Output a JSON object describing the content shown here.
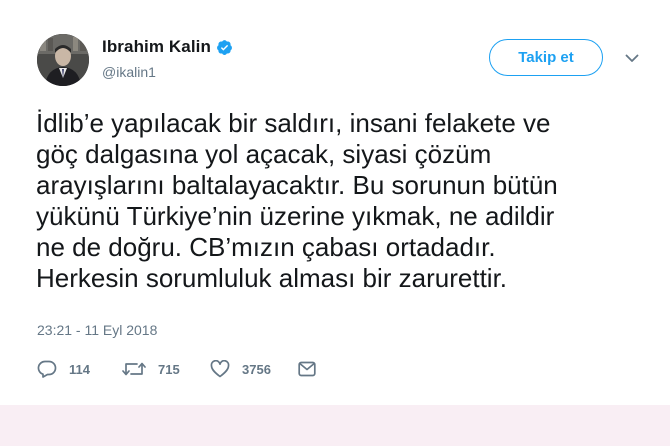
{
  "user": {
    "display_name": "Ibrahim Kalin",
    "handle": "@ikalin1",
    "verified": true,
    "avatar_icon": "profile-photo"
  },
  "follow_button": {
    "label": "Takip et"
  },
  "menu": {
    "icon": "chevron-down-icon"
  },
  "tweet": {
    "text": "İdlib’e yapılacak bir saldırı, insani felakete ve\ngöç dalgasına yol açacak, siyasi çözüm\narayışlarını baltalayacaktır. Bu sorunun bütün\nyükünü Türkiye’nin üzerine yıkmak, ne adildir\nne de doğru. CB’mızın çabası ortadadır.\nHerkesin sorumluluk alması bir zarurettir.",
    "timestamp": "23:21 - 11 Eyl 2018"
  },
  "actions": {
    "reply_count": "114",
    "retweet_count": "715",
    "like_count": "3756",
    "icons": [
      "reply-icon",
      "retweet-icon",
      "like-icon",
      "message-icon"
    ]
  },
  "colors": {
    "accent": "#1da1f2",
    "text": "#14171a",
    "muted": "#657786",
    "band": "#f9eef4"
  }
}
